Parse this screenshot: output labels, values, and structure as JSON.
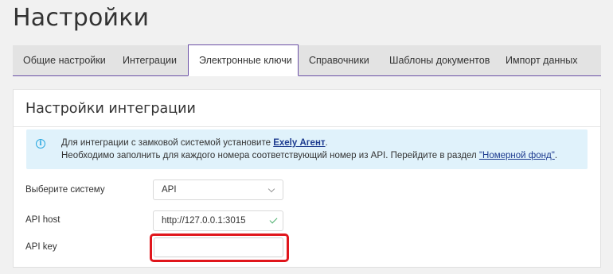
{
  "page": {
    "title": "Настройки"
  },
  "tabs": [
    {
      "label": "Общие настройки",
      "active": false
    },
    {
      "label": "Интеграции",
      "active": false
    },
    {
      "label": "Электронные ключи",
      "active": true
    },
    {
      "label": "Справочники",
      "active": false
    },
    {
      "label": "Шаблоны документов",
      "active": false
    },
    {
      "label": "Импорт данных",
      "active": false
    }
  ],
  "section": {
    "title": "Настройки интеграции"
  },
  "alert": {
    "icon": "info-icon",
    "line1_prefix": "Для интеграции с замковой системой установите ",
    "line1_link": "Exely Агент",
    "line1_suffix": ".",
    "line2_prefix": "Необходимо заполнить для каждого номера соответствующий номер из API. Перейдите в раздел ",
    "line2_link": "\"Номерной фонд\"",
    "line2_suffix": "."
  },
  "form": {
    "system_label": "Выберите систему",
    "system_value": "API",
    "host_label": "API host",
    "host_value": "http://127.0.0.1:3015",
    "key_label": "API key",
    "key_value": ""
  },
  "colors": {
    "accent": "#6b4fa6",
    "alert_bg": "#e0f2fb",
    "highlight": "#e0161c",
    "valid": "#4caf6d"
  }
}
